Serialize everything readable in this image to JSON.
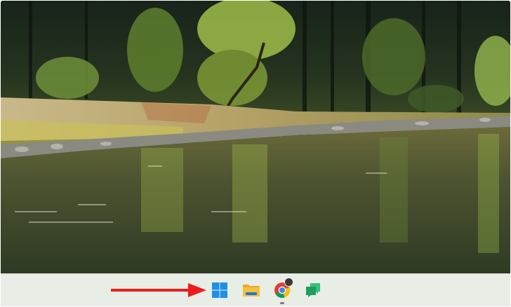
{
  "colors": {
    "taskbar": "#e8ede6",
    "start_blue": "#1e90e8",
    "arrow": "#ee1c1c",
    "folder": "#f5c03c",
    "chrome_red": "#db4437",
    "chrome_yellow": "#f4c20d",
    "chrome_green": "#0f9d58",
    "chrome_blue": "#4285f4",
    "chat_green": "#1e9e5a"
  },
  "desktop": {
    "wallpaper": "forest-river-landscape"
  },
  "taskbar": {
    "items": [
      {
        "name": "start-button",
        "icon": "windows-logo-icon"
      },
      {
        "name": "file-explorer-button",
        "icon": "folder-icon"
      },
      {
        "name": "chrome-button",
        "icon": "chrome-icon",
        "running": true
      },
      {
        "name": "chat-button",
        "icon": "chat-icon"
      }
    ]
  },
  "annotation": {
    "icon": "red-arrow-icon",
    "points_to": "start-button"
  }
}
